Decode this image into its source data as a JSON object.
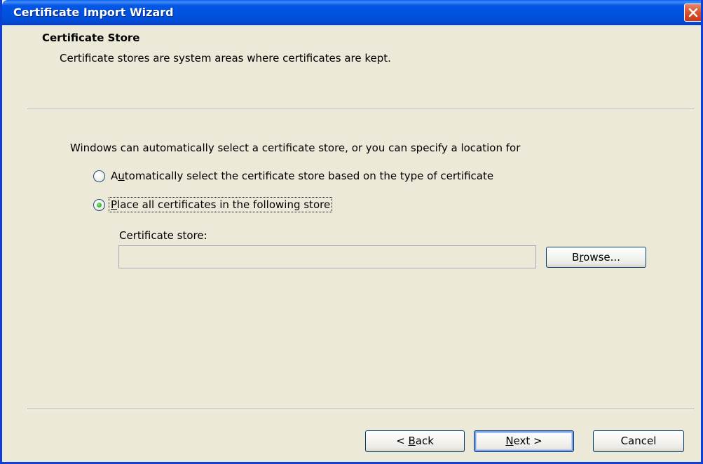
{
  "window": {
    "title": "Certificate Import Wizard",
    "close_icon": "close-x-icon"
  },
  "header": {
    "title": "Certificate Store",
    "subtitle": "Certificate stores are system areas where certificates are kept."
  },
  "body": {
    "intro": "Windows can automatically select a certificate store, or you can specify a location for",
    "options": [
      {
        "label_prefix": "",
        "label_accel": "u",
        "label_first": "A",
        "label_rest": "tomatically select the certificate store based on the type of certificate",
        "selected": false
      },
      {
        "label_accel": "P",
        "label_rest": "lace all certificates in the following store",
        "selected": true
      }
    ],
    "store_label": "Certificate store:",
    "store_value": "",
    "browse": {
      "pre": "B",
      "accel": "r",
      "post": "owse..."
    }
  },
  "footer": {
    "back": {
      "pre": "< ",
      "accel": "B",
      "post": "ack"
    },
    "next": {
      "accel": "N",
      "post": "ext >"
    },
    "cancel": "Cancel"
  }
}
